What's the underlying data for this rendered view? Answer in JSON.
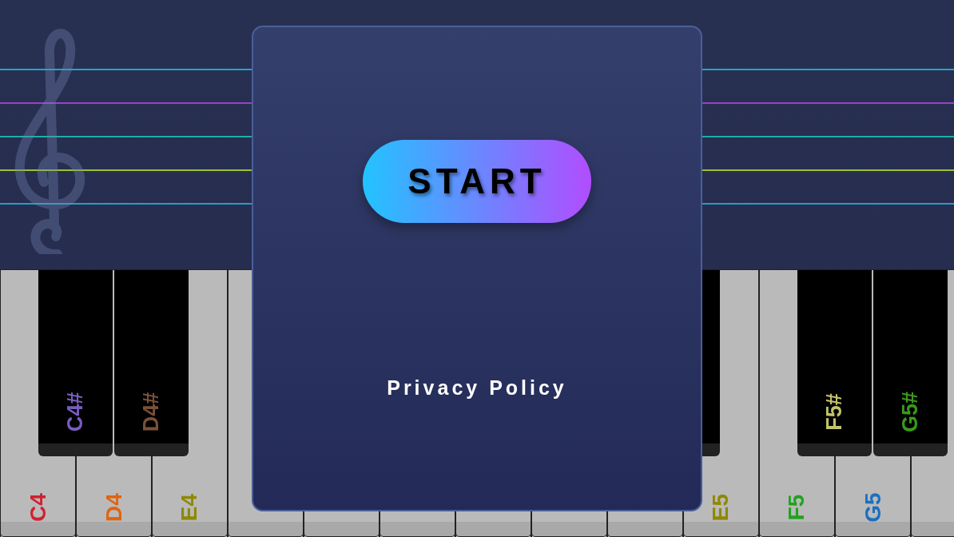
{
  "staff_lines": [
    {
      "color": "#1fa5c8"
    },
    {
      "color": "#9b3fc7"
    },
    {
      "color": "#18b0a8"
    },
    {
      "color": "#9bc22e"
    },
    {
      "color": "#2a9bc8"
    }
  ],
  "white_keys": [
    {
      "kind": "labeled",
      "label": "C4",
      "color": "#d0202e"
    },
    {
      "kind": "labeled",
      "label": "D4",
      "color": "#e0640f"
    },
    {
      "kind": "labeled",
      "label": "E4",
      "color": "#8f8800"
    },
    {
      "kind": "blank"
    },
    {
      "kind": "blank"
    },
    {
      "kind": "blank"
    },
    {
      "kind": "blank"
    },
    {
      "kind": "blank"
    },
    {
      "kind": "blank"
    },
    {
      "kind": "labeled",
      "label": "E5",
      "color": "#8f8800"
    },
    {
      "kind": "labeled",
      "label": "F5",
      "color": "#1fa31f"
    },
    {
      "kind": "labeled",
      "label": "G5",
      "color": "#1a6fc0"
    },
    {
      "kind": "blank"
    }
  ],
  "black_keys": [
    {
      "kind": "labeled",
      "label": "C4#",
      "color": "#7a5cc0"
    },
    {
      "kind": "labeled",
      "label": "D4#",
      "color": "#7a5038"
    },
    {
      "kind": "blank"
    },
    {
      "kind": "labeled",
      "label": "F5#",
      "color": "#c2c26a"
    },
    {
      "kind": "labeled",
      "label": "G5#",
      "color": "#3a9a1a"
    }
  ],
  "dialog": {
    "start_button": "START",
    "privacy_link": "Privacy Policy"
  }
}
